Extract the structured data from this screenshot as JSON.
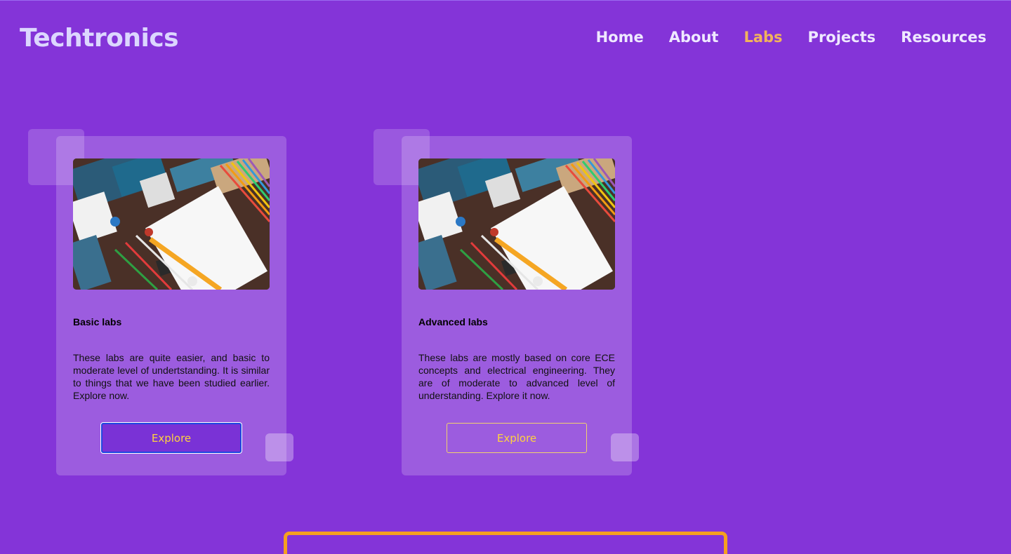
{
  "brand": {
    "logo_text": "Techtronics"
  },
  "nav": {
    "items": [
      {
        "label": "Home"
      },
      {
        "label": "About"
      },
      {
        "label": "Labs"
      },
      {
        "label": "Projects"
      },
      {
        "label": "Resources"
      }
    ],
    "active": "Labs"
  },
  "cards": [
    {
      "title": "Basic labs",
      "description": "These labs are quite easier, and basic to moderate level of undertstanding. It is similar to things that we have been studied earlier. Explore now.",
      "button_label": "Explore",
      "image_alt": "electronics components on a desk with notebook"
    },
    {
      "title": "Advanced labs",
      "description": "These labs are mostly based on core ECE concepts and electrical engineering. They are of moderate to advanced level of understanding. Explore it now.",
      "button_label": "Explore",
      "image_alt": "electronics components on a desk with notebook"
    }
  ],
  "colors": {
    "background": "#8434d8",
    "logo": "#dcd6ff",
    "nav_text": "#efe9ff",
    "nav_active": "#f2b35c",
    "button_text": "#ffd23f",
    "bottom_box_border": "#f5a020"
  }
}
